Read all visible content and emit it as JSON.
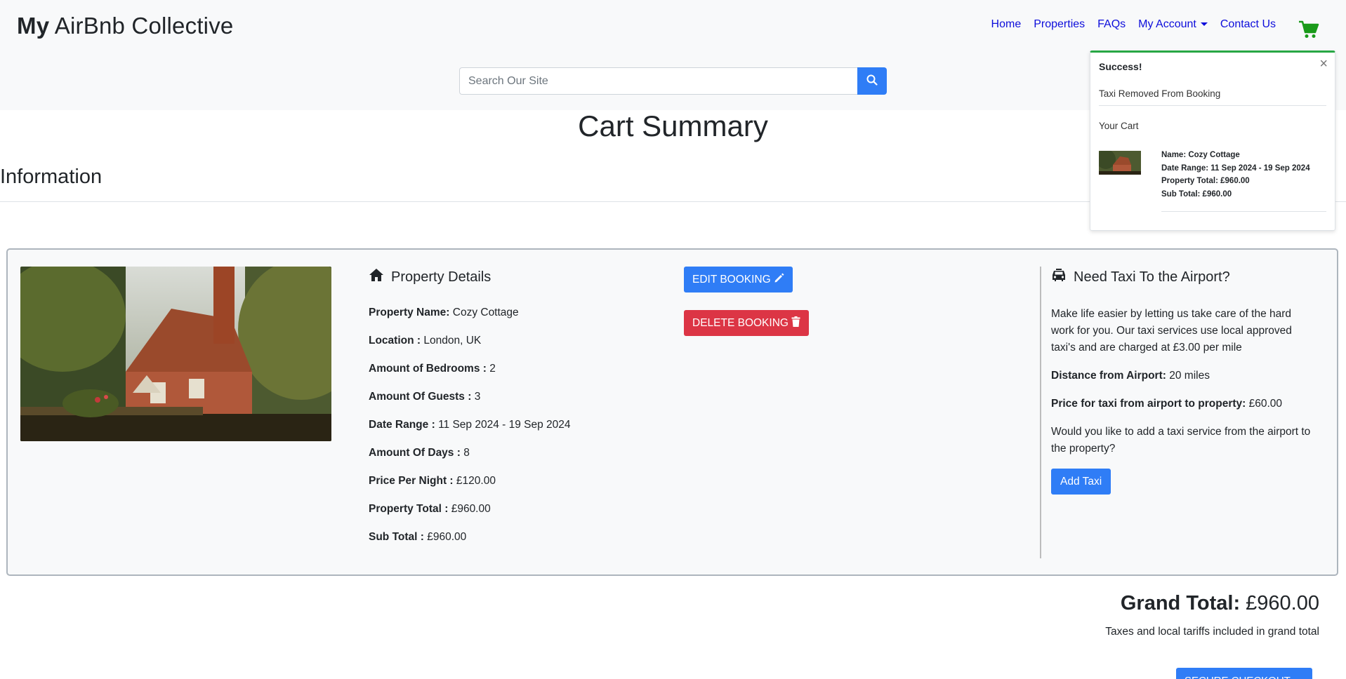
{
  "brand": {
    "bold": "My",
    "rest": " AirBnb Collective"
  },
  "nav": {
    "items": [
      "Home",
      "Properties",
      "FAQs",
      "My Account",
      "Contact Us"
    ],
    "cart_icon": "shopping-cart-icon",
    "cart_color": "#1a9a1a"
  },
  "search": {
    "placeholder": "Search Our Site",
    "icon": "search-icon"
  },
  "page": {
    "title": "Cart Summary",
    "section": "Information"
  },
  "property": {
    "heading": "Property Details",
    "fields": [
      {
        "label": "Property Name:",
        "value": "Cozy Cottage"
      },
      {
        "label": "Location :",
        "value": "London, UK"
      },
      {
        "label": "Amount of Bedrooms :",
        "value": "2"
      },
      {
        "label": "Amount Of Guests :",
        "value": "3"
      },
      {
        "label": "Date Range :",
        "value": "11 Sep 2024 - 19 Sep 2024"
      },
      {
        "label": "Amount Of Days :",
        "value": "8"
      },
      {
        "label": "Price Per Night :",
        "value": "£120.00"
      },
      {
        "label": "Property Total :",
        "value": "£960.00"
      },
      {
        "label": "Sub Total :",
        "value": "£960.00"
      }
    ]
  },
  "actions": {
    "edit": "EDIT BOOKING",
    "delete": "DELETE BOOKING"
  },
  "taxi": {
    "heading": "Need Taxi To the Airport?",
    "description": "Make life easier by letting us take care of the hard work for you. Our taxi services use local approved taxi's and are charged at £3.00 per mile",
    "distance_label": "Distance from Airport:",
    "distance_value": "20 miles",
    "price_label": "Price for taxi from airport to property:",
    "price_value": "£60.00",
    "question": "Would you like to add a taxi service from the airport to the property?",
    "button": "Add Taxi"
  },
  "totals": {
    "grand_label": "Grand Total:",
    "grand_value": "£960.00",
    "note": "Taxes and local tariffs included in grand total",
    "checkout": "SECURE CHECKOUT"
  },
  "toast": {
    "title": "Success!",
    "close": "×",
    "message": "Taxi Removed From Booking",
    "cart_label": "Your Cart",
    "lines": [
      "Name: Cozy Cottage",
      "Date Range: 11 Sep 2024 - 19 Sep 2024",
      "Property Total: £960.00",
      "Sub Total: £960.00"
    ],
    "accent": "#28a745"
  },
  "colors": {
    "primary": "#2f7df6",
    "danger": "#dc3545",
    "link": "#0d0ddb"
  }
}
